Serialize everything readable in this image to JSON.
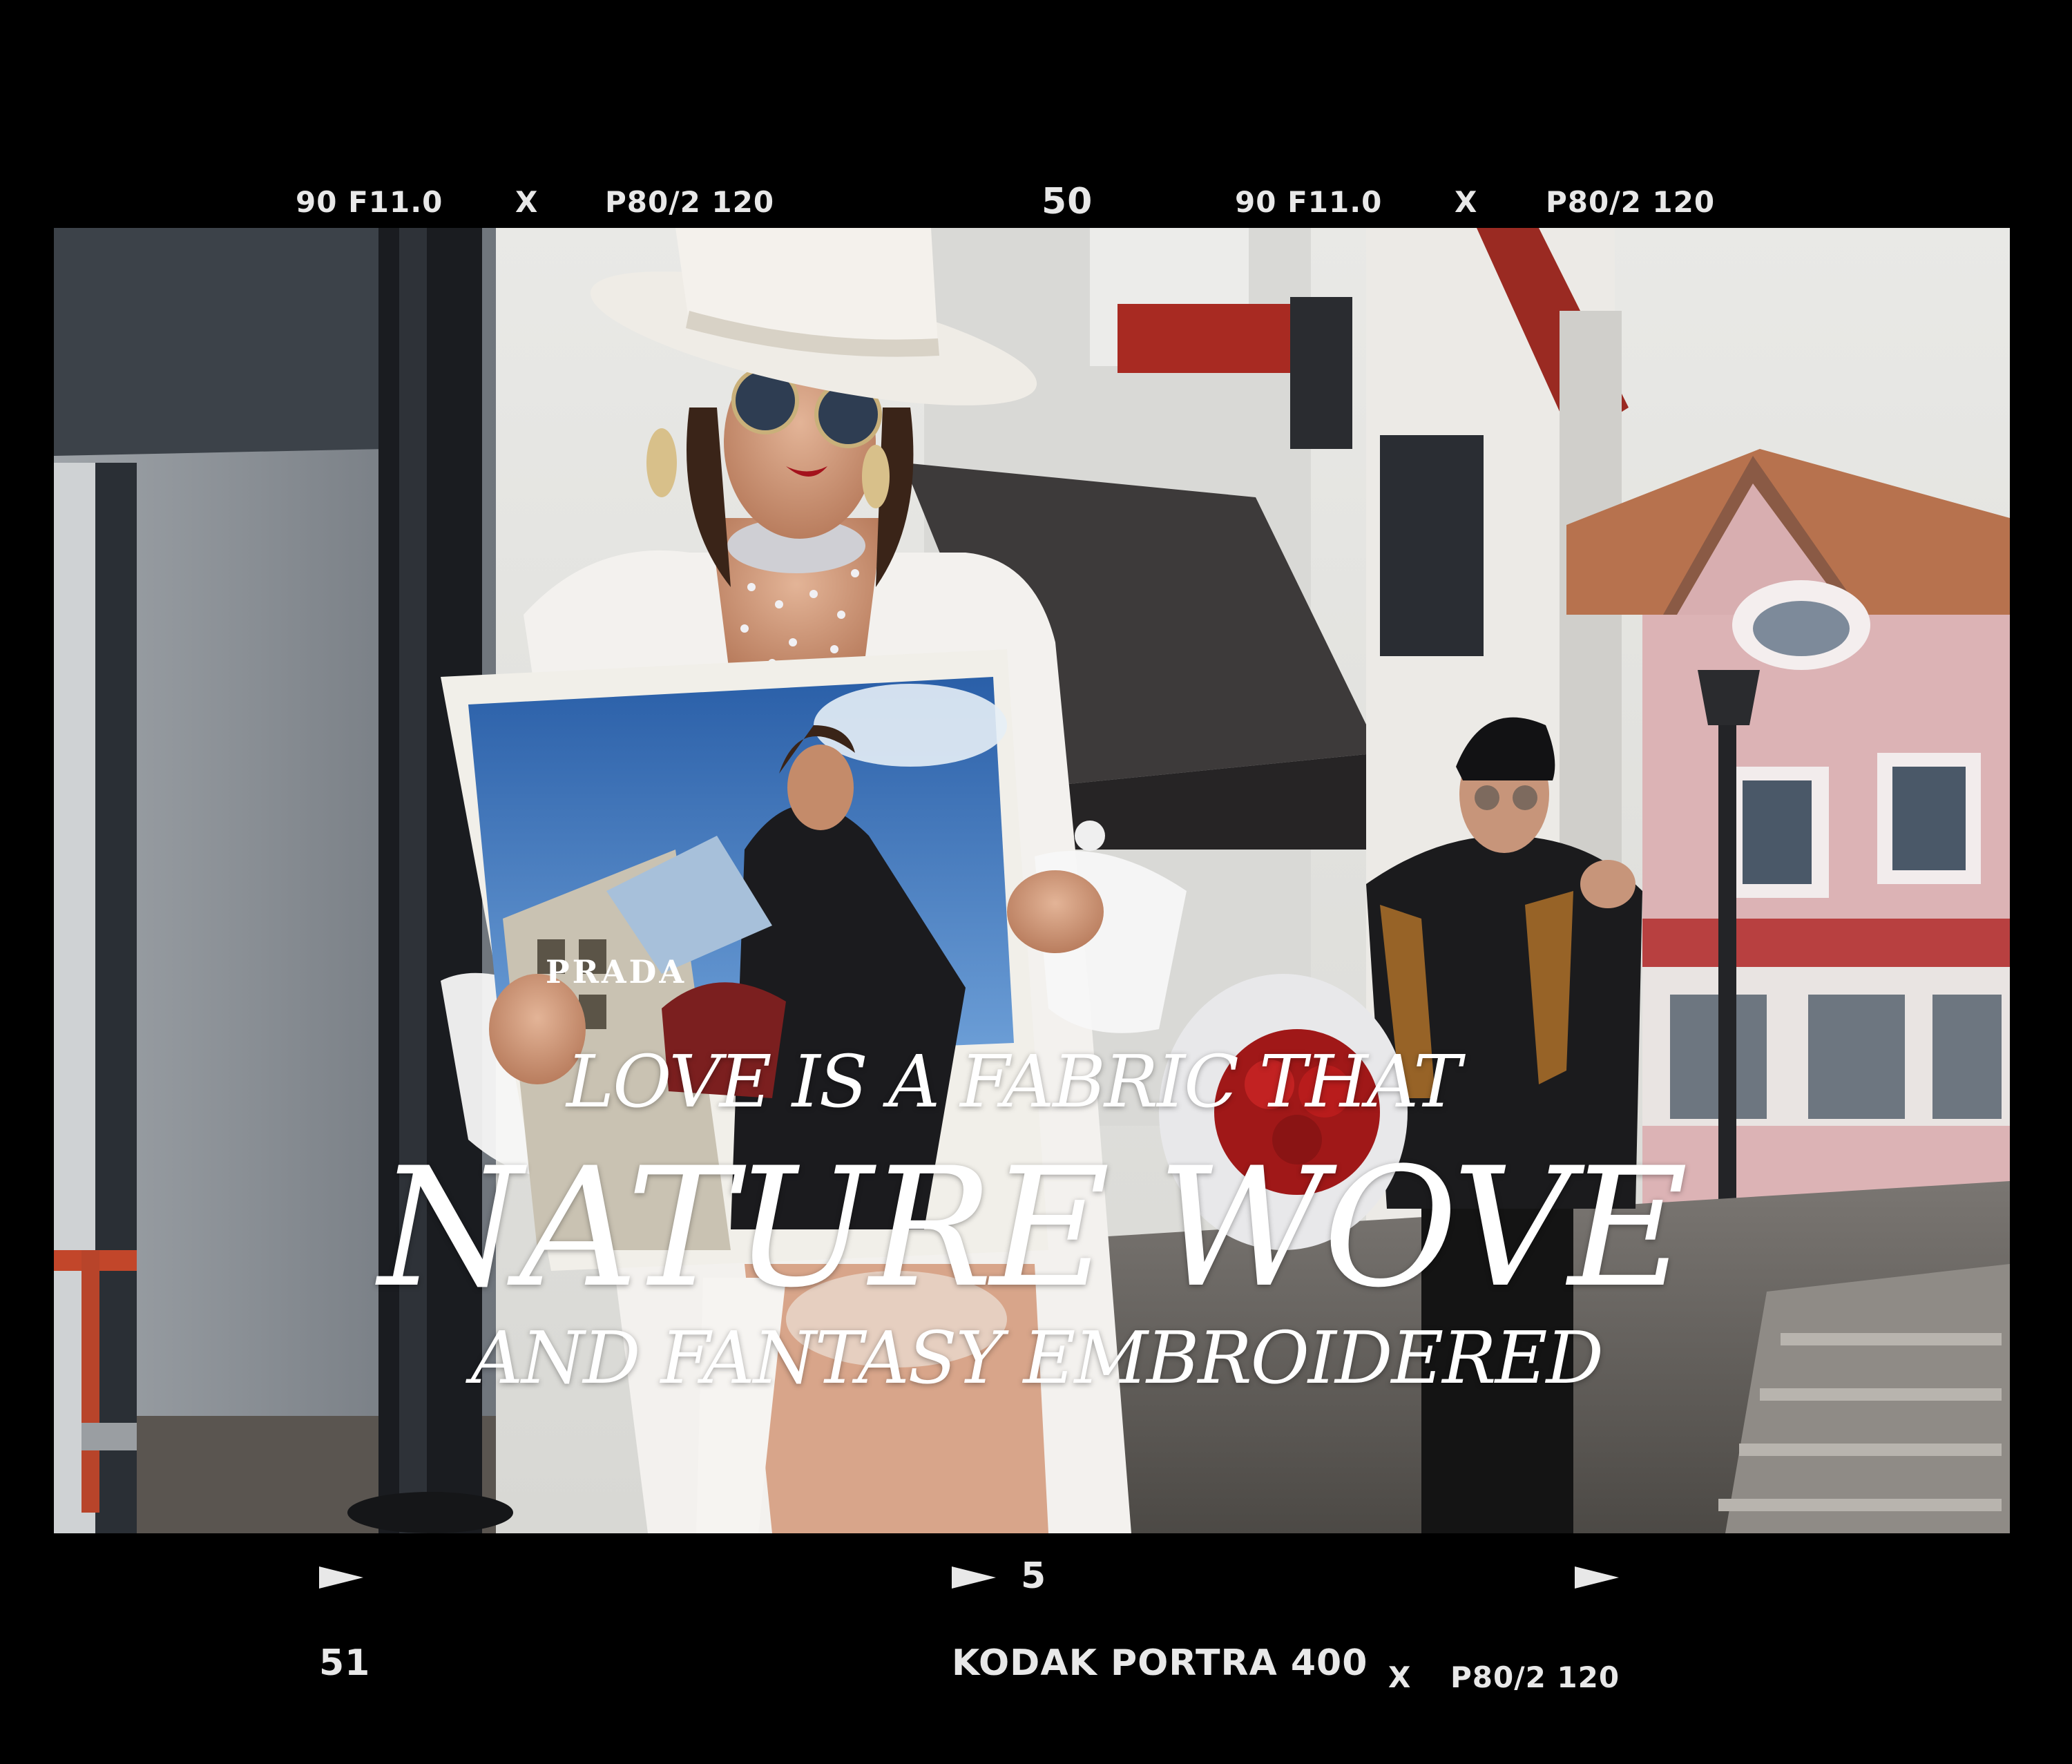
{
  "film_edge": {
    "top_left_exposure": "90 F11.0",
    "top_left_x": "X",
    "top_left_format": "P80/2 120",
    "top_frame_number": "50",
    "top_right_exposure": "90 F11.0",
    "top_right_x": "X",
    "top_right_format": "P80/2 120",
    "bottom_frame_marker": "5",
    "bottom_left_number": "51",
    "film_stock": "KODAK PORTRA 400",
    "bottom_x": "X",
    "bottom_format": "P80/2 120"
  },
  "photo": {
    "magazine_brand": "PRADA"
  },
  "headline": {
    "line1": "LOVE IS A FABRIC THAT",
    "line2": "NATURE WOVE",
    "line3": "AND FANTASY EMBROIDERED"
  },
  "colors": {
    "frame": "#000000",
    "edge_text": "#e8e8e8",
    "headline": "#ffffff"
  }
}
